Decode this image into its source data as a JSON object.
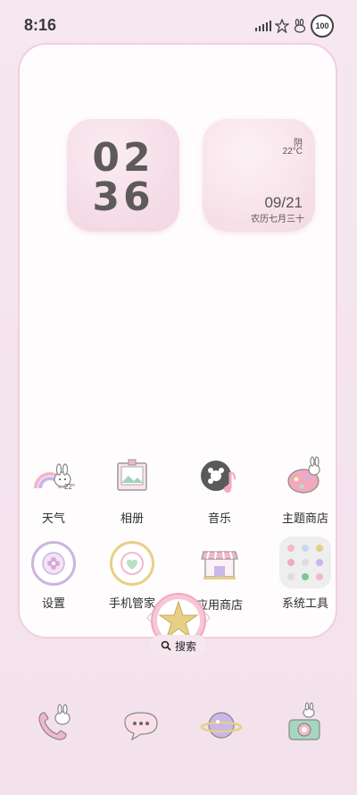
{
  "status": {
    "time": "8:16",
    "battery": "100"
  },
  "widgets": {
    "clock": {
      "hours": "02",
      "minutes": "36"
    },
    "weather": {
      "condition": "阴",
      "temperature": "22°C",
      "date": "09/21",
      "lunar": "农历七月三十"
    }
  },
  "apps": [
    {
      "label": "天气",
      "icon": "weather-icon"
    },
    {
      "label": "相册",
      "icon": "gallery-icon"
    },
    {
      "label": "音乐",
      "icon": "music-icon"
    },
    {
      "label": "主题商店",
      "icon": "theme-store-icon"
    },
    {
      "label": "设置",
      "icon": "settings-icon"
    },
    {
      "label": "手机管家",
      "icon": "phone-manager-icon"
    },
    {
      "label": "应用商店",
      "icon": "app-store-icon"
    },
    {
      "label": "系统工具",
      "icon": "system-tools-folder-icon"
    }
  ],
  "weather_icon_temp": "22°",
  "search": {
    "label": "搜索"
  },
  "dock": [
    {
      "icon": "phone-icon"
    },
    {
      "icon": "messages-icon"
    },
    {
      "icon": "browser-icon"
    },
    {
      "icon": "camera-icon"
    }
  ],
  "colors": {
    "background": "#f6e7f0",
    "frame_border": "#f0cfe0",
    "accent_pink": "#f3b7cc",
    "star_gold": "#e8cf86"
  }
}
